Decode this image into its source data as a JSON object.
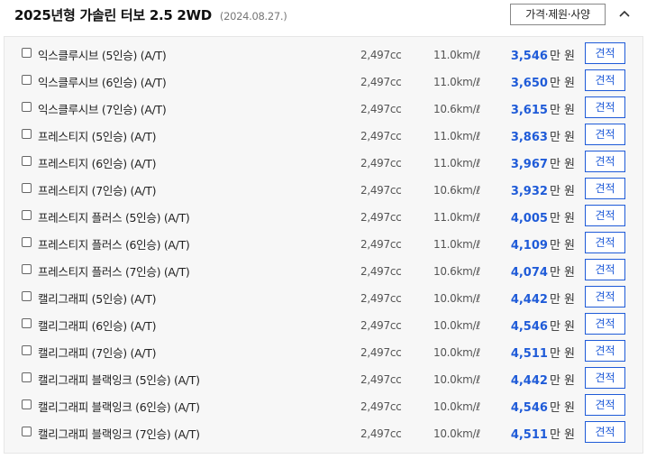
{
  "header": {
    "title": "2025년형 가솔린 터보 2.5 2WD",
    "date": "(2024.08.27.)",
    "spec_button_label": "가격·제원·사양"
  },
  "trims": [
    {
      "name": "익스클루시브 (5인승) (A/T)",
      "displacement": "2,497cc",
      "efficiency": "11.0km/ℓ",
      "price": "3,546",
      "price_unit": "만 원",
      "quote_label": "견적"
    },
    {
      "name": "익스클루시브 (6인승) (A/T)",
      "displacement": "2,497cc",
      "efficiency": "11.0km/ℓ",
      "price": "3,650",
      "price_unit": "만 원",
      "quote_label": "견적"
    },
    {
      "name": "익스클루시브 (7인승) (A/T)",
      "displacement": "2,497cc",
      "efficiency": "10.6km/ℓ",
      "price": "3,615",
      "price_unit": "만 원",
      "quote_label": "견적"
    },
    {
      "name": "프레스티지 (5인승) (A/T)",
      "displacement": "2,497cc",
      "efficiency": "11.0km/ℓ",
      "price": "3,863",
      "price_unit": "만 원",
      "quote_label": "견적"
    },
    {
      "name": "프레스티지 (6인승) (A/T)",
      "displacement": "2,497cc",
      "efficiency": "11.0km/ℓ",
      "price": "3,967",
      "price_unit": "만 원",
      "quote_label": "견적"
    },
    {
      "name": "프레스티지 (7인승) (A/T)",
      "displacement": "2,497cc",
      "efficiency": "10.6km/ℓ",
      "price": "3,932",
      "price_unit": "만 원",
      "quote_label": "견적"
    },
    {
      "name": "프레스티지 플러스 (5인승) (A/T)",
      "displacement": "2,497cc",
      "efficiency": "11.0km/ℓ",
      "price": "4,005",
      "price_unit": "만 원",
      "quote_label": "견적"
    },
    {
      "name": "프레스티지 플러스 (6인승) (A/T)",
      "displacement": "2,497cc",
      "efficiency": "11.0km/ℓ",
      "price": "4,109",
      "price_unit": "만 원",
      "quote_label": "견적"
    },
    {
      "name": "프레스티지 플러스 (7인승) (A/T)",
      "displacement": "2,497cc",
      "efficiency": "10.6km/ℓ",
      "price": "4,074",
      "price_unit": "만 원",
      "quote_label": "견적"
    },
    {
      "name": "캘리그래피 (5인승) (A/T)",
      "displacement": "2,497cc",
      "efficiency": "10.0km/ℓ",
      "price": "4,442",
      "price_unit": "만 원",
      "quote_label": "견적"
    },
    {
      "name": "캘리그래피 (6인승) (A/T)",
      "displacement": "2,497cc",
      "efficiency": "10.0km/ℓ",
      "price": "4,546",
      "price_unit": "만 원",
      "quote_label": "견적"
    },
    {
      "name": "캘리그래피 (7인승) (A/T)",
      "displacement": "2,497cc",
      "efficiency": "10.0km/ℓ",
      "price": "4,511",
      "price_unit": "만 원",
      "quote_label": "견적"
    },
    {
      "name": "캘리그래피 블랙잉크 (5인승) (A/T)",
      "displacement": "2,497cc",
      "efficiency": "10.0km/ℓ",
      "price": "4,442",
      "price_unit": "만 원",
      "quote_label": "견적"
    },
    {
      "name": "캘리그래피 블랙잉크 (6인승) (A/T)",
      "displacement": "2,497cc",
      "efficiency": "10.0km/ℓ",
      "price": "4,546",
      "price_unit": "만 원",
      "quote_label": "견적"
    },
    {
      "name": "캘리그래피 블랙잉크 (7인승) (A/T)",
      "displacement": "2,497cc",
      "efficiency": "10.0km/ℓ",
      "price": "4,511",
      "price_unit": "만 원",
      "quote_label": "견적"
    }
  ],
  "colors": {
    "price": "#1f5bd8",
    "quote_button_border": "#1f5bd8",
    "panel_background": "#f7f7f7"
  },
  "icons": {
    "collapse": "chevron-up-icon",
    "checkbox": "checkbox-icon"
  }
}
